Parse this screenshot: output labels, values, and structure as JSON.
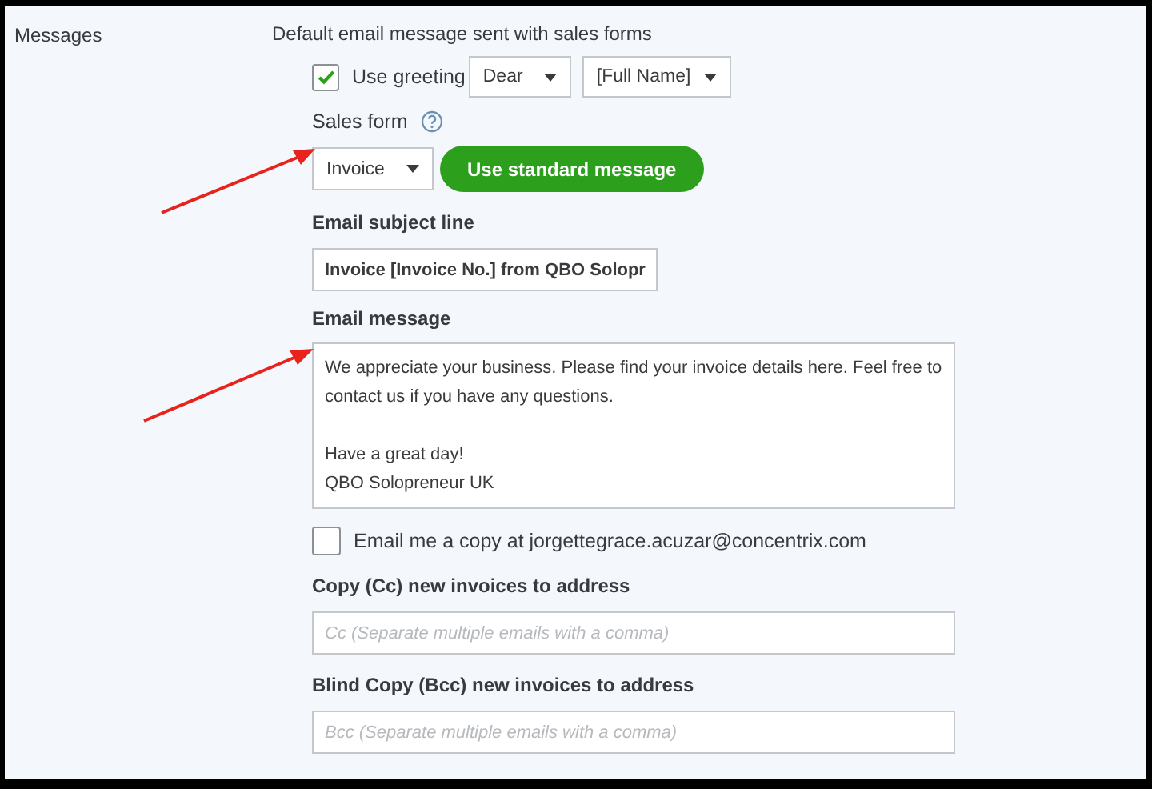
{
  "section": {
    "label": "Messages",
    "heading": "Default email message sent with sales forms"
  },
  "greeting": {
    "label": "Use greeting",
    "checked": true,
    "salutation": "Dear",
    "name_format": "[Full Name]"
  },
  "sales_form": {
    "label": "Sales form",
    "value": "Invoice",
    "button": "Use standard message"
  },
  "subject": {
    "label": "Email subject line",
    "value": "Invoice [Invoice No.] from QBO Solopr"
  },
  "message": {
    "label": "Email message",
    "value": "We appreciate your business. Please find your invoice details here. Feel free to contact us if you have any questions.\n\nHave a great day!\nQBO Solopreneur UK"
  },
  "copy_me": {
    "label": "Email me a copy at jorgettegrace.acuzar@concentrix.com",
    "checked": false
  },
  "cc": {
    "label": "Copy (Cc) new invoices to address",
    "placeholder": "Cc (Separate multiple emails with a comma)"
  },
  "bcc": {
    "label": "Blind Copy (Bcc) new invoices to address",
    "placeholder": "Bcc (Separate multiple emails with a comma)"
  }
}
